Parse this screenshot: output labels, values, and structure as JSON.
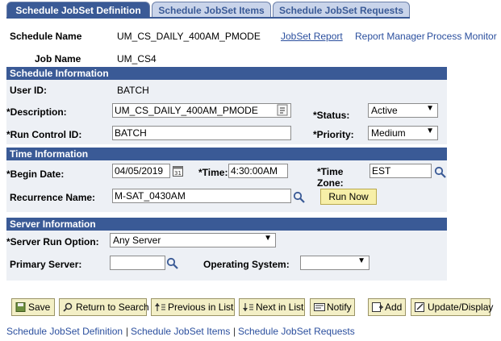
{
  "tabs": [
    {
      "label": "Schedule JobSet Definition",
      "active": true
    },
    {
      "label": "Schedule JobSet Items",
      "active": false
    },
    {
      "label": "Schedule JobSet Requests",
      "active": false
    }
  ],
  "header": {
    "schedule_name_label": "Schedule Name",
    "schedule_name_value": "UM_CS_DAILY_400AM_PMODE",
    "job_name_label": "Job Name",
    "job_name_value": "UM_CS4",
    "jobset_report_link": "JobSet Report",
    "report_manager_link": "Report Manager",
    "process_monitor_link": "Process Monitor"
  },
  "schedule_info": {
    "title": "Schedule Information",
    "user_id_label": "User ID:",
    "user_id_value": "BATCH",
    "description_label": "*Description:",
    "description_value": "UM_CS_DAILY_400AM_PMODE",
    "status_label": "*Status:",
    "status_value": "Active",
    "run_control_label": "*Run Control ID:",
    "run_control_value": "BATCH",
    "priority_label": "*Priority:",
    "priority_value": "Medium"
  },
  "time_info": {
    "title": "Time Information",
    "begin_date_label": "*Begin Date:",
    "begin_date_value": "04/05/2019",
    "time_label": "*Time:",
    "time_value": "4:30:00AM",
    "time_zone_label_1": "*Time",
    "time_zone_label_2": "Zone:",
    "time_zone_value": "EST",
    "recurrence_label": "Recurrence Name:",
    "recurrence_value": "M-SAT_0430AM",
    "run_now_label": "Run Now"
  },
  "server_info": {
    "title": "Server Information",
    "run_option_label": "*Server Run Option:",
    "run_option_value": "Any Server",
    "primary_server_label": "Primary Server:",
    "primary_server_value": "",
    "os_label": "Operating System:",
    "os_value": ""
  },
  "toolbar": {
    "save": "Save",
    "return": "Return to Search",
    "previous": "Previous in List",
    "next": "Next in List",
    "notify": "Notify",
    "add": "Add",
    "update": "Update/Display"
  },
  "footer": {
    "link1": "Schedule JobSet Definition",
    "link2": "Schedule JobSet Items",
    "link3": "Schedule JobSet Requests",
    "separator": "|"
  },
  "colors": {
    "accent": "#3a5a96",
    "tab_inactive": "#c9d4ea",
    "section_bg": "#edf0f5",
    "button_bg": "#f3efc6",
    "link": "#2b4f9e"
  }
}
